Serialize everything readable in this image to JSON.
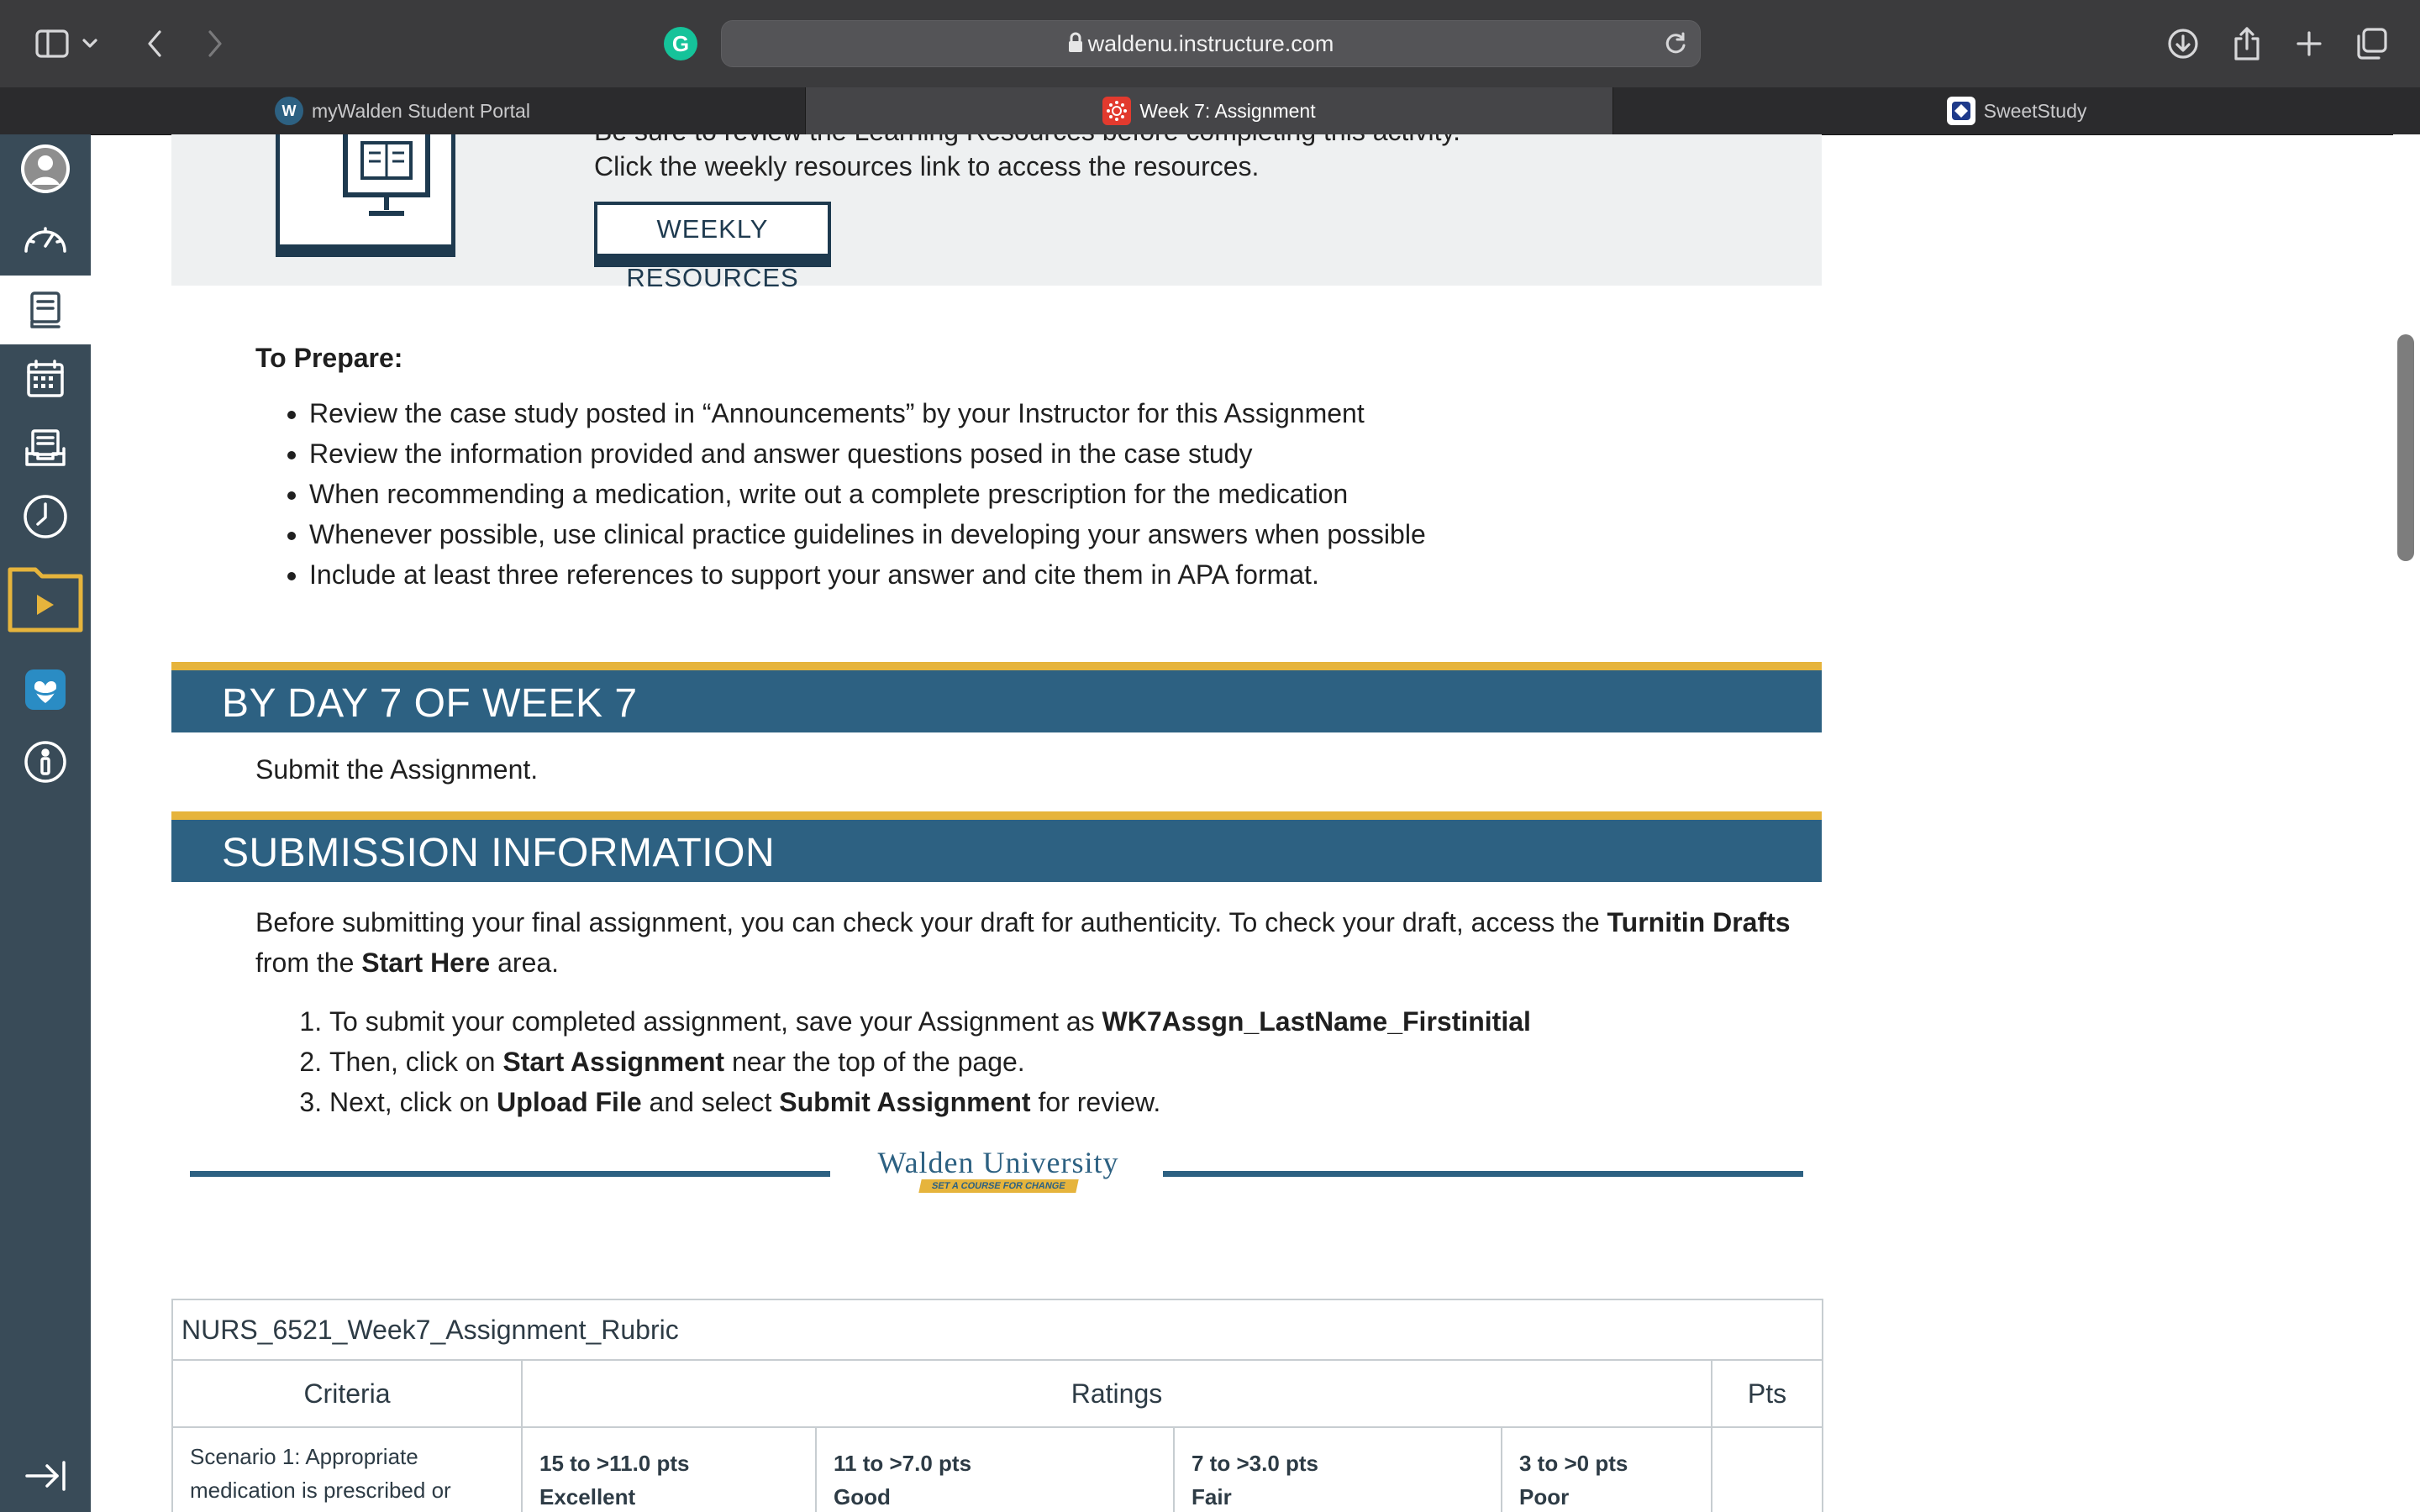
{
  "browser": {
    "url": "waldenu.instructure.com",
    "grammarly_letter": "G",
    "tabs": [
      {
        "label": "myWalden Student Portal",
        "icon": "walden-w-icon",
        "favicon_letter": "W"
      },
      {
        "label": "Week 7: Assignment",
        "icon": "canvas-icon",
        "active": true
      },
      {
        "label": "SweetStudy",
        "icon": "sweetstudy-icon"
      }
    ]
  },
  "canvas_nav": {
    "items": [
      "account-icon",
      "dashboard-icon",
      "courses-icon",
      "calendar-icon",
      "inbox-icon",
      "history-icon",
      "studio-icon",
      "commons-icon",
      "help-icon"
    ],
    "collapse": "collapse-nav-icon",
    "active": "courses-icon"
  },
  "resources": {
    "line1": "Be sure to review the Learning Resources before completing this activity.",
    "line2": "Click the weekly resources link to access the resources.",
    "button": "WEEKLY RESOURCES"
  },
  "prepare": {
    "heading": "To Prepare:",
    "items": [
      "Review the case study posted in “Announcements” by your Instructor for this Assignment",
      "Review the information provided and answer questions posed in the case study",
      "When recommending a medication, write out a complete prescription for the medication",
      "Whenever possible, use clinical practice guidelines in developing your answers when possible",
      "Include at least three references to support your answer and cite them in APA format."
    ]
  },
  "day7": {
    "banner": "BY DAY 7 OF WEEK 7",
    "text": "Submit the Assignment."
  },
  "submission": {
    "banner": "SUBMISSION INFORMATION",
    "intro_a": "Before submitting your final assignment, you can check your draft for authenticity. To check your draft, access the ",
    "intro_b": "Turnitin Drafts",
    "intro_c": "from the ",
    "intro_d": "Start Here",
    "intro_e": " area.",
    "steps": [
      {
        "a": "To submit your completed assignment, save your Assignment as ",
        "b": "WK7Assgn_LastName_Firstinitial",
        "c": "",
        "d": "",
        "e": ""
      },
      {
        "a": "Then, click on ",
        "b": "Start Assignment",
        "c": " near the top of the page.",
        "d": "",
        "e": ""
      },
      {
        "a": "Next, click on ",
        "b": "Upload File",
        "c": " and select ",
        "d": "Submit Assignment",
        "e": " for review."
      }
    ]
  },
  "logo": {
    "name": "Walden University",
    "tagline": "SET A COURSE FOR CHANGE"
  },
  "rubric": {
    "title": "NURS_6521_Week7_Assignment_Rubric",
    "headers": {
      "criteria": "Criteria",
      "ratings": "Ratings",
      "pts": "Pts"
    },
    "row1": {
      "criteria": "Scenario 1: Appropriate medication is prescribed or",
      "ratings": [
        {
          "pts": "15 to >11.0 pts",
          "label": "Excellent"
        },
        {
          "pts": "11 to >7.0 pts",
          "label": "Good"
        },
        {
          "pts": "7 to >3.0 pts",
          "label": "Fair"
        },
        {
          "pts": "3 to >0 pts",
          "label": "Poor"
        }
      ]
    }
  },
  "colors": {
    "banner_blue": "#2d6182",
    "banner_gold": "#e6b43c",
    "nav_bg": "#394b58",
    "navy": "#1e3a4f"
  }
}
